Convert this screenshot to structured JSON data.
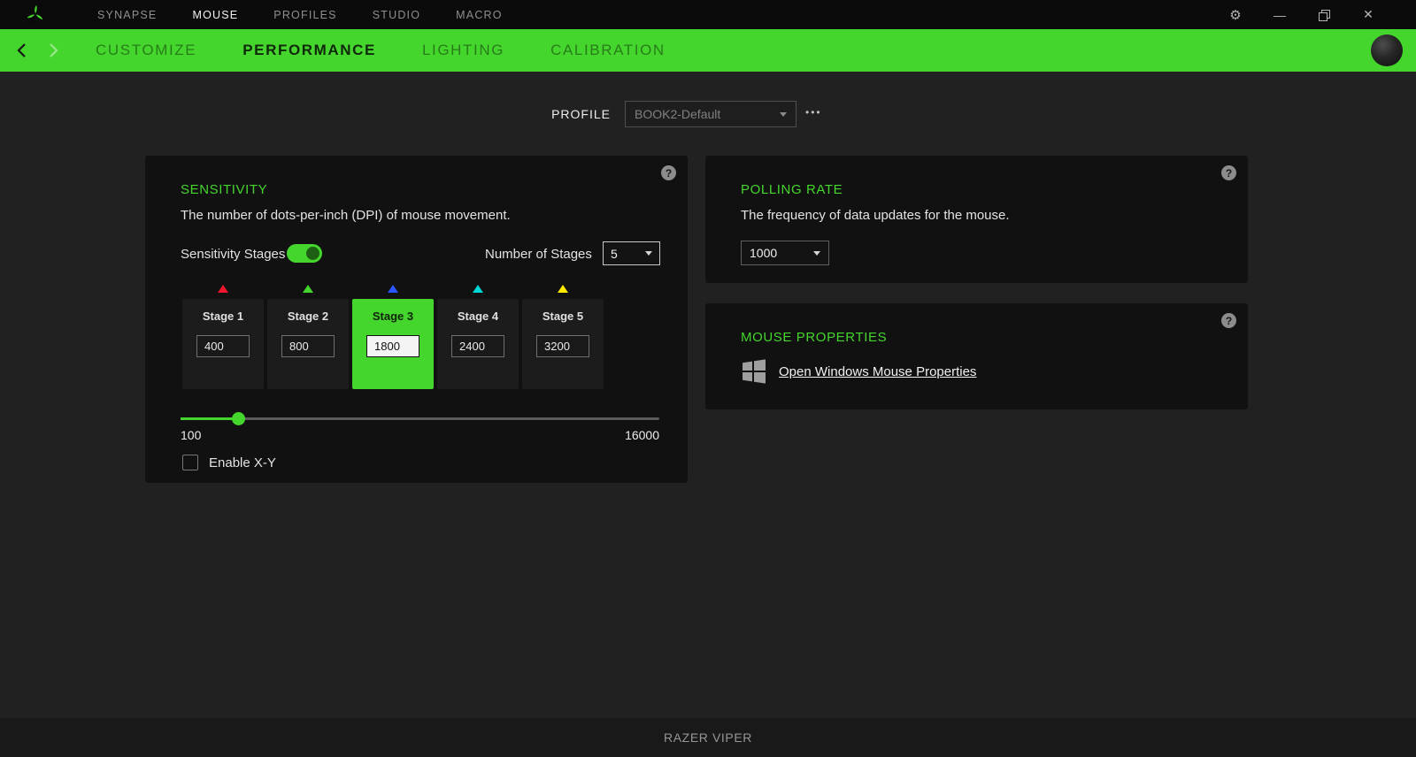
{
  "colors": {
    "accent": "#44d62c",
    "titlebar_bg": "#0b0b0b",
    "card_bg": "#111111",
    "content_bg": "#212121"
  },
  "icons": {
    "gear": "⚙",
    "minimize": "—",
    "close": "✕",
    "more": "•••",
    "help": "?"
  },
  "titlebar": {
    "nav": [
      {
        "label": "SYNAPSE",
        "active": false
      },
      {
        "label": "MOUSE",
        "active": true
      },
      {
        "label": "PROFILES",
        "active": false
      },
      {
        "label": "STUDIO",
        "active": false
      },
      {
        "label": "MACRO",
        "active": false
      }
    ]
  },
  "subnav": {
    "tabs": [
      {
        "label": "CUSTOMIZE",
        "active": false
      },
      {
        "label": "PERFORMANCE",
        "active": true
      },
      {
        "label": "LIGHTING",
        "active": false
      },
      {
        "label": "CALIBRATION",
        "active": false
      }
    ]
  },
  "profile": {
    "label": "PROFILE",
    "selected": "BOOK2-Default"
  },
  "sensitivity": {
    "title": "SENSITIVITY",
    "description": "The number of dots-per-inch (DPI) of mouse movement.",
    "stages_toggle_label": "Sensitivity Stages",
    "stages_toggle_on": true,
    "number_of_stages_label": "Number of Stages",
    "number_of_stages_value": "5",
    "stages": [
      {
        "label": "Stage 1",
        "value": "400",
        "color": "#f2152f",
        "selected": false
      },
      {
        "label": "Stage 2",
        "value": "800",
        "color": "#44d62c",
        "selected": false
      },
      {
        "label": "Stage 3",
        "value": "1800",
        "color": "#2b55ff",
        "selected": true
      },
      {
        "label": "Stage 4",
        "value": "2400",
        "color": "#00d7d7",
        "selected": false
      },
      {
        "label": "Stage 5",
        "value": "3200",
        "color": "#ffe900",
        "selected": false
      }
    ],
    "slider": {
      "min_label": "100",
      "max_label": "16000",
      "fill_width": "12.2%"
    },
    "enable_xy_label": "Enable X-Y",
    "enable_xy_checked": false
  },
  "polling_rate": {
    "title": "POLLING RATE",
    "description": "The frequency of data updates for the mouse.",
    "value": "1000"
  },
  "mouse_properties": {
    "title": "MOUSE PROPERTIES",
    "link_label": "Open Windows Mouse Properties"
  },
  "footer": {
    "device_name": "RAZER VIPER"
  }
}
